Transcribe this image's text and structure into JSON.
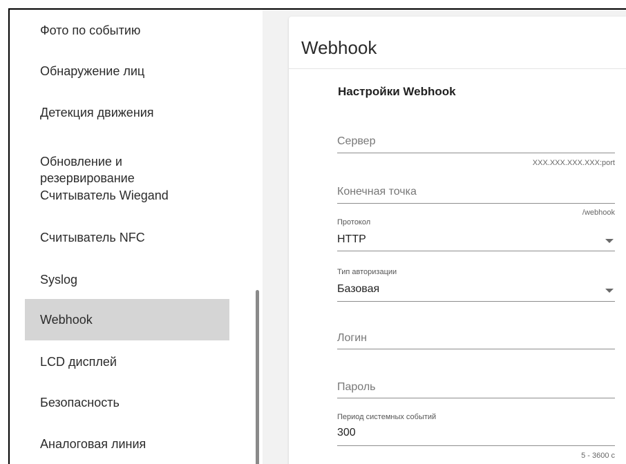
{
  "sidebar": {
    "items": [
      {
        "label": "Фото по событию"
      },
      {
        "label": "Обнаружение лиц"
      },
      {
        "label": "Детекция движения"
      },
      {
        "label": "Обновление и\nрезервирование"
      },
      {
        "label": "Считыватель Wiegand"
      },
      {
        "label": "Считыватель NFC"
      },
      {
        "label": "Syslog"
      },
      {
        "label": "Webhook",
        "active": true
      },
      {
        "label": "LCD дисплей"
      },
      {
        "label": "Безопасность"
      },
      {
        "label": "Аналоговая линия"
      }
    ]
  },
  "card": {
    "title": "Webhook",
    "section_title": "Настройки Webhook",
    "fields": {
      "server": {
        "placeholder": "Сервер",
        "hint": "XXX.XXX.XXX.XXX:port"
      },
      "endpoint": {
        "placeholder": "Конечная точка",
        "hint": "/webhook"
      },
      "protocol": {
        "label": "Протокол",
        "value": "HTTP"
      },
      "auth_type": {
        "label": "Тип авторизации",
        "value": "Базовая"
      },
      "login": {
        "placeholder": "Логин"
      },
      "password": {
        "placeholder": "Пароль"
      },
      "period": {
        "label": "Период системных событий",
        "value": "300",
        "hint": "5 - 3600 с"
      }
    }
  },
  "icons": {
    "dropdown": "chevron-down-icon"
  }
}
